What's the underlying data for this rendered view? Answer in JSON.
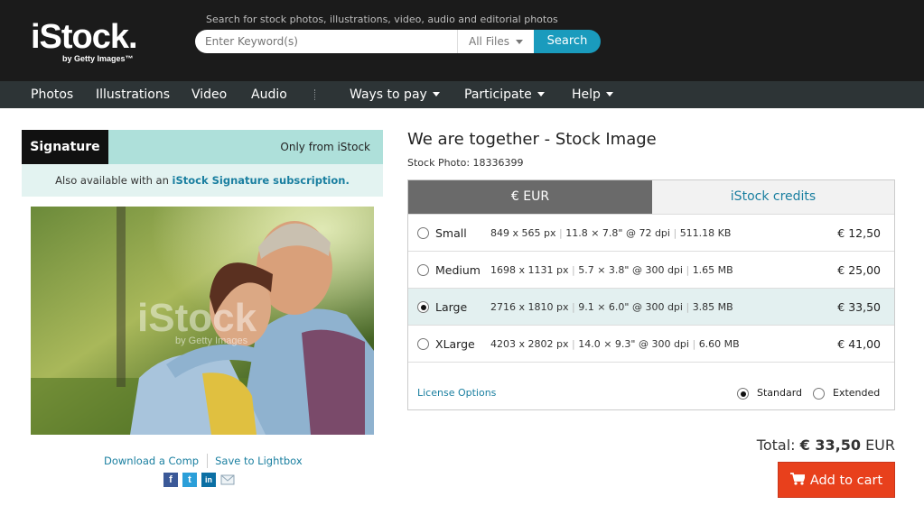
{
  "header": {
    "logo_text": "iStock.",
    "logo_sub": "by Getty Images™",
    "search_caption": "Search for stock photos, illustrations, video, audio and editorial photos",
    "search_placeholder": "Enter Keyword(s)",
    "filter_value": "All Files",
    "search_button": "Search"
  },
  "nav": {
    "items": [
      "Photos",
      "Illustrations",
      "Video",
      "Audio"
    ],
    "menus": [
      "Ways to pay",
      "Participate",
      "Help"
    ]
  },
  "signature": {
    "label": "Signature",
    "only_from": "Only from iStock",
    "also_text": "Also available with an ",
    "also_link": "iStock Signature subscription."
  },
  "image": {
    "watermark": "iStock",
    "watermark_sub": "by Getty Images"
  },
  "image_actions": {
    "download_comp": "Download a Comp",
    "save_lightbox": "Save to Lightbox",
    "social": [
      "facebook-icon",
      "twitter-icon",
      "linkedin-icon",
      "email-icon"
    ]
  },
  "product": {
    "title": "We are together - Stock Image",
    "stock_id": "Stock Photo: 18336399"
  },
  "pricing": {
    "tabs": [
      "€ EUR",
      "iStock credits"
    ],
    "sizes": [
      {
        "name": "Small",
        "px": "849 x 565 px",
        "inches": "11.8 × 7.8\" @ 72 dpi",
        "filesize": "511.18 KB",
        "price": "€ 12,50",
        "selected": false
      },
      {
        "name": "Medium",
        "px": "1698 x 1131 px",
        "inches": "5.7 × 3.8\" @ 300 dpi",
        "filesize": "1.65 MB",
        "price": "€ 25,00",
        "selected": false
      },
      {
        "name": "Large",
        "px": "2716 x 1810 px",
        "inches": "9.1 × 6.0\" @ 300 dpi",
        "filesize": "3.85 MB",
        "price": "€ 33,50",
        "selected": true
      },
      {
        "name": "XLarge",
        "px": "4203 x 2802 px",
        "inches": "14.0 × 9.3\" @ 300 dpi",
        "filesize": "6.60 MB",
        "price": "€ 41,00",
        "selected": false
      }
    ],
    "license_link": "License Options",
    "license_standard": "Standard",
    "license_extended": "Extended"
  },
  "cart": {
    "total_label": "Total:",
    "total_value": "€ 33,50",
    "currency": "EUR",
    "add_button": "Add to cart"
  },
  "colors": {
    "accent": "#1a9bbd",
    "cart": "#e8401c",
    "signature_bg": "#aee0da"
  }
}
